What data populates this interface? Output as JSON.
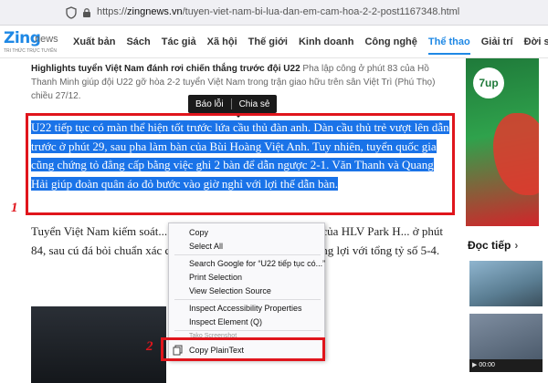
{
  "browser": {
    "url_scheme": "https://",
    "url_host": "zingnews.vn",
    "url_path": "/tuyen-viet-nam-bi-lua-dan-em-cam-hoa-2-2-post1167348.html"
  },
  "site": {
    "logo_main": "Zing",
    "logo_news": "news",
    "logo_tagline": "TRI THỨC TRỰC TUYẾN",
    "nav": [
      "Xuất bản",
      "Sách",
      "Tác giả",
      "Xã hội",
      "Thế giới",
      "Kinh doanh",
      "Công nghệ",
      "Thể thao",
      "Giải trí",
      "Đời sống"
    ],
    "active_nav_index": 7,
    "accent": "#1e88e5"
  },
  "article": {
    "lead_title": "Highlights tuyển Việt Nam đánh rơi chiến thắng trước đội U22",
    "lead_text": " Pha lập công ở phút 83 của Hồ Thanh Minh giúp đội U22 gỡ hòa 2-2 tuyển Việt Nam trong trận giao hữu trên sân Việt Trì (Phú Thọ) chiều 27/12.",
    "selected_paragraph": "U22 tiếp tục có màn thể hiện tốt trước lứa cầu thủ đàn anh. Dàn cầu thủ trẻ vượt lên dẫn trước ở phút 29, sau pha làm bàn của Bùi Hoàng Việt Anh. Tuy nhiên, tuyển quốc gia cũng chứng tỏ đẳng cấp bằng việc ghi 2 bàn để dẫn ngược 2-1. Văn Thanh và Quang Hải giúp đoàn quân áo đỏ bước vào giờ nghỉ với lợi thế dẫn bàn.",
    "next_paragraph": "Tuyển Việt Nam kiếm soát... thêm bàn trong hiệp 2. Dàn sao của HLV Park H... ở phút 84, sau cú đá bỏi chuẩn xác của Thanh ... Việt Nam giành thắng lợi với tổng tỷ số 5-4."
  },
  "tooltip": {
    "report": "Báo lỗi",
    "share": "Chia sẻ"
  },
  "context_menu": {
    "copy": "Copy",
    "select_all": "Select All",
    "search_google": "Search Google for “U22 tiếp tục có...”",
    "print_selection": "Print Selection",
    "view_selection_source": "View Selection Source",
    "inspect_accessibility": "Inspect Accessibility Properties",
    "inspect_element": "Inspect Element (Q)",
    "partial_item": "Tako Screenshot",
    "copy_plaintext": "Copy PlainText"
  },
  "annotations": {
    "label_1": "1",
    "label_2": "2",
    "highlight_color": "#e0151c",
    "selection_color": "#1a73e8"
  },
  "sidebar": {
    "ad_brand": "7up",
    "doc_tiep": "Đọc tiếp",
    "video_time": "00:00"
  }
}
